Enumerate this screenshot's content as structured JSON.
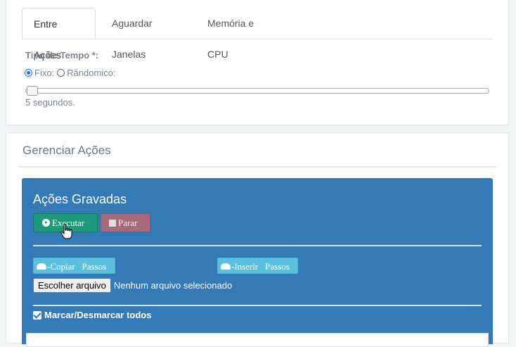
{
  "tabs": [
    {
      "label": "Entre Ações",
      "active": true
    },
    {
      "label": "Aguardar Janelas",
      "active": false
    },
    {
      "label": "Memória e CPU",
      "active": false
    }
  ],
  "tempo": {
    "label": "Tipo de Tempo *:",
    "options": [
      {
        "label": "Fixo:",
        "checked": true
      },
      {
        "label": "Rândomico:",
        "checked": false
      }
    ],
    "slider_fraction": 0.0,
    "slider_text": "5 segundos."
  },
  "manage": {
    "section_title": "Gerenciar Ações",
    "panel_title": "Ações Gravadas",
    "execute_label": "Executar",
    "stop_label": "Parar",
    "copy_label": "-Copiar   Passos",
    "insert_label": "-Inserir   Passos",
    "file_button_label": "Escolher arquivo",
    "file_status": "Nenhum arquivo selecionado",
    "select_all_label": "Marcar/Desmarcar todos"
  },
  "colors": {
    "panel": "#337ab7",
    "execute": "#1e9a7a",
    "stop": "#a66a7c",
    "info": "#5bc0de",
    "radio_checked": "#1a73e8"
  }
}
